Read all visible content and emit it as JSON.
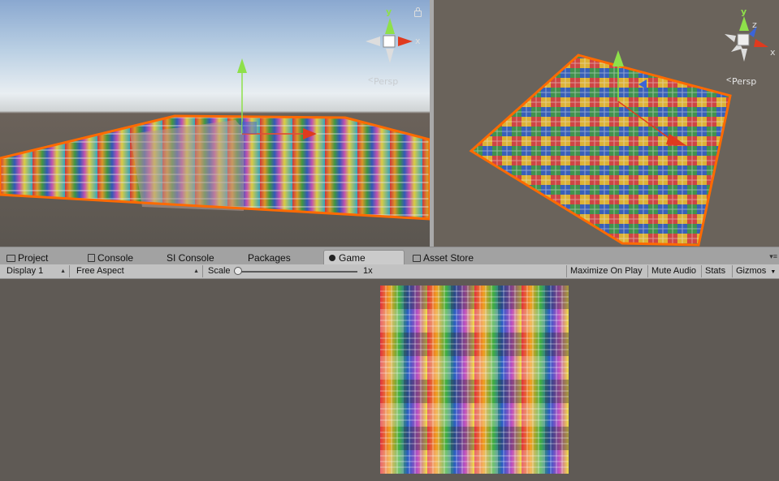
{
  "scene_view_left": {
    "gizmo_axes": {
      "y": "y",
      "x": "x"
    },
    "projection_label": "Persp"
  },
  "scene_view_right": {
    "gizmo_axes": {
      "y": "y",
      "z": "z",
      "x": "x"
    },
    "projection_label": "Persp"
  },
  "tabs": [
    {
      "label": "Project",
      "icon": "folder-icon"
    },
    {
      "label": "Console",
      "icon": "console-icon"
    },
    {
      "label": "SI Console",
      "icon": ""
    },
    {
      "label": "Packages",
      "icon": ""
    },
    {
      "label": "Game",
      "icon": "game-icon",
      "active": true
    },
    {
      "label": "Asset Store",
      "icon": "store-icon"
    }
  ],
  "game_toolbar": {
    "display": "Display 1",
    "aspect": "Free Aspect",
    "scale_label": "Scale",
    "scale_value": "1x",
    "maximize_on_play": "Maximize On Play",
    "mute_audio": "Mute Audio",
    "stats": "Stats",
    "gizmos": "Gizmos"
  },
  "colors": {
    "selection_outline": "#ff6a00",
    "axis_x": "#e03a1e",
    "axis_y": "#8ee04a",
    "axis_z": "#3a64d8"
  }
}
